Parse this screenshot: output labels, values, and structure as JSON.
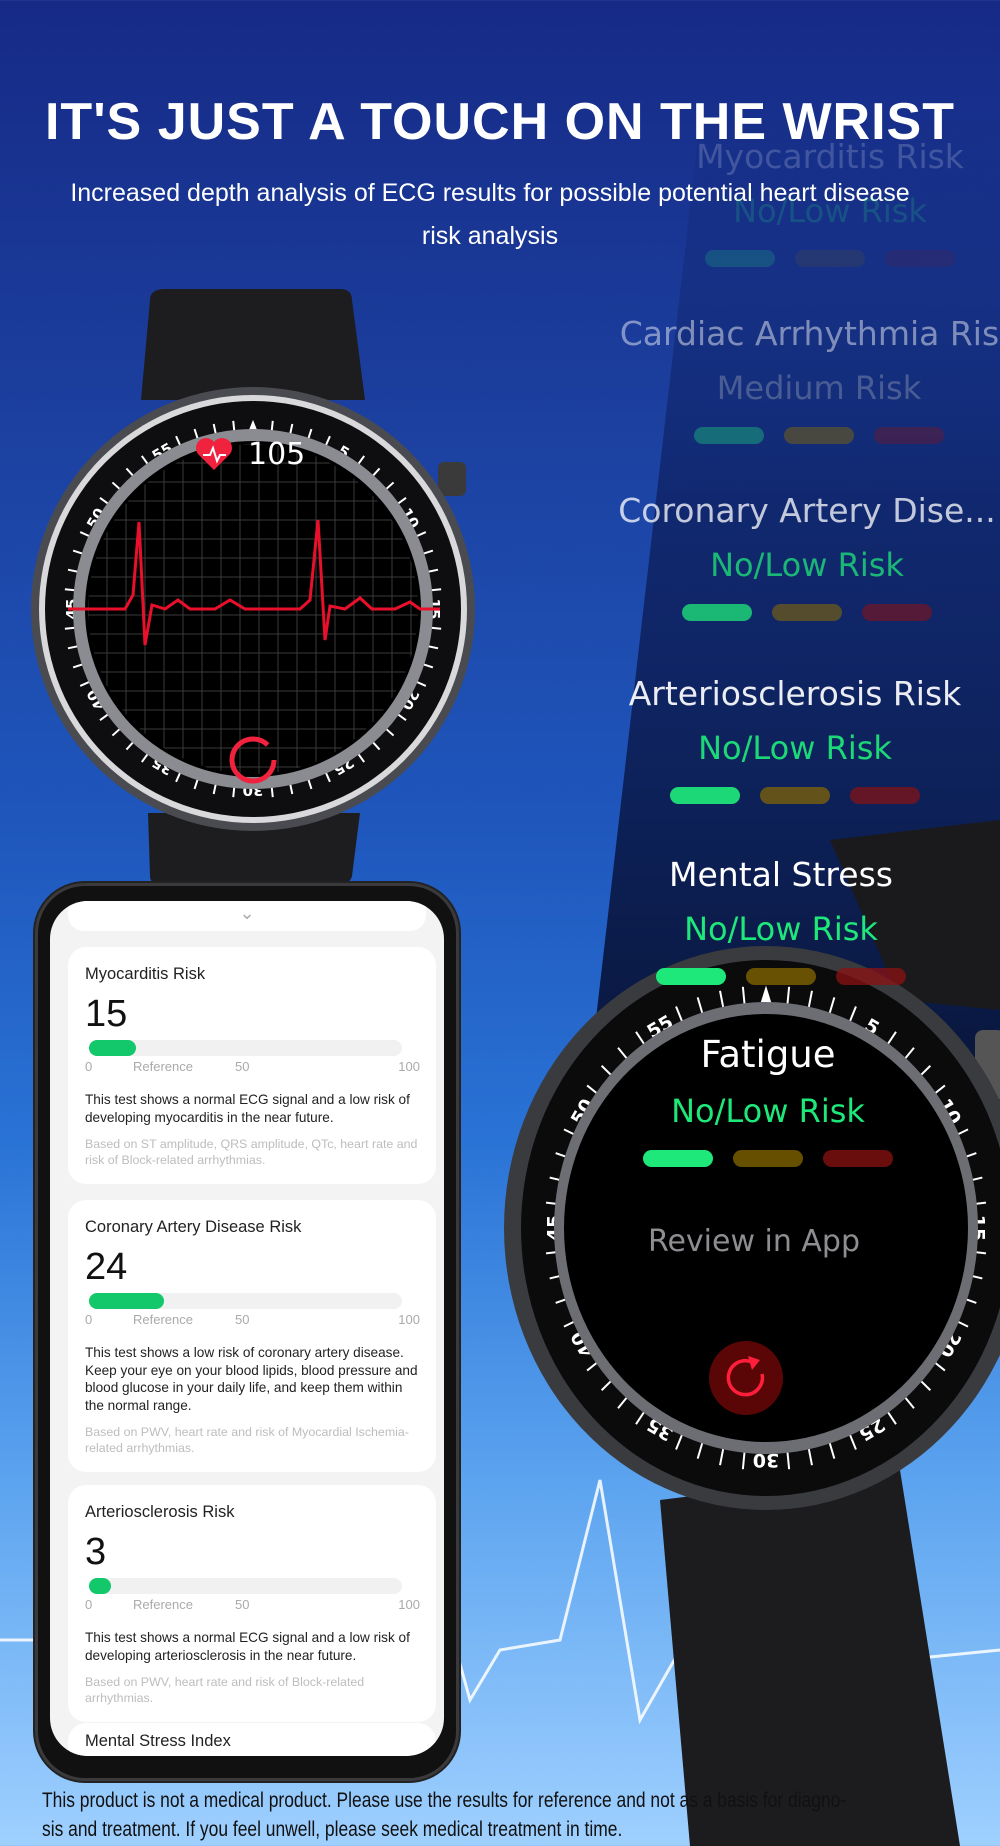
{
  "header": {
    "title": "IT'S JUST A TOUCH ON THE WRIST",
    "subtitle": "Increased depth analysis of ECG results for possible potential heart disease risk analysis"
  },
  "watch_left": {
    "heart_rate": "105",
    "heart_icon": "heart-icon",
    "bezel_numbers": [
      "5",
      "10",
      "15",
      "20",
      "25",
      "30",
      "35",
      "40",
      "45",
      "50",
      "55"
    ]
  },
  "watch_right": {
    "bezel_numbers": [
      "5",
      "10",
      "15",
      "20",
      "25",
      "30",
      "35",
      "40",
      "45",
      "50",
      "55"
    ]
  },
  "risk_panel": {
    "items": [
      {
        "title": "Myocarditis Risk",
        "level": "No/Low Risk",
        "active": 0
      },
      {
        "title": "Cardiac Arrhythmia Risk",
        "level": "Medium Risk",
        "active": 1
      },
      {
        "title": "Coronary Artery Dise...",
        "level": "No/Low Risk",
        "active": 0
      },
      {
        "title": "Arteriosclerosis Risk",
        "level": "No/Low Risk",
        "active": 0
      },
      {
        "title": "Mental Stress",
        "level": "No/Low Risk",
        "active": 0
      },
      {
        "title": "Fatigue",
        "level": "No/Low Risk",
        "active": 0
      }
    ],
    "review_label": "Review in App",
    "retry_icon": "refresh-icon"
  },
  "phone": {
    "cards": [
      {
        "title": "Myocarditis Risk",
        "value": 15,
        "scale": {
          "min": "0",
          "reference": "Reference",
          "mid": "50",
          "max": "100"
        },
        "description": "This test shows a normal ECG signal and a low risk of developing myocarditis in the near future.",
        "basis": "Based on ST amplitude, QRS amplitude, QTc, heart rate and risk of Block-related arrhythmias."
      },
      {
        "title": "Coronary Artery Disease Risk",
        "value": 24,
        "scale": {
          "min": "0",
          "reference": "Reference",
          "mid": "50",
          "max": "100"
        },
        "description": "This test shows a low risk of coronary artery disease. Keep your eye on your blood lipids, blood pressure and blood glucose in your daily life, and keep them within the normal range.",
        "basis": "Based on PWV, heart rate and risk of Myocardial Ischemia-related arrhythmias."
      },
      {
        "title": "Arteriosclerosis Risk",
        "value": 3,
        "scale": {
          "min": "0",
          "reference": "Reference",
          "mid": "50",
          "max": "100"
        },
        "description": "This test shows a normal ECG signal and a low risk of developing arteriosclerosis in the near future.",
        "basis": "Based on PWV, heart rate and risk of Block-related arrhythmias."
      }
    ],
    "partial_card_title": "Mental Stress Index"
  },
  "disclaimer": {
    "line1": "This product is not a medical product. Please use the results for reference and not as a basis for diagno-",
    "line2": "sis and treatment. If you feel unwell, please seek medical treatment in time."
  },
  "colors": {
    "low": "#1ee87a",
    "medium": "#8a6a00",
    "high": "#8c1212",
    "ecg_line": "#e8102a",
    "progress": "#12c86a"
  }
}
